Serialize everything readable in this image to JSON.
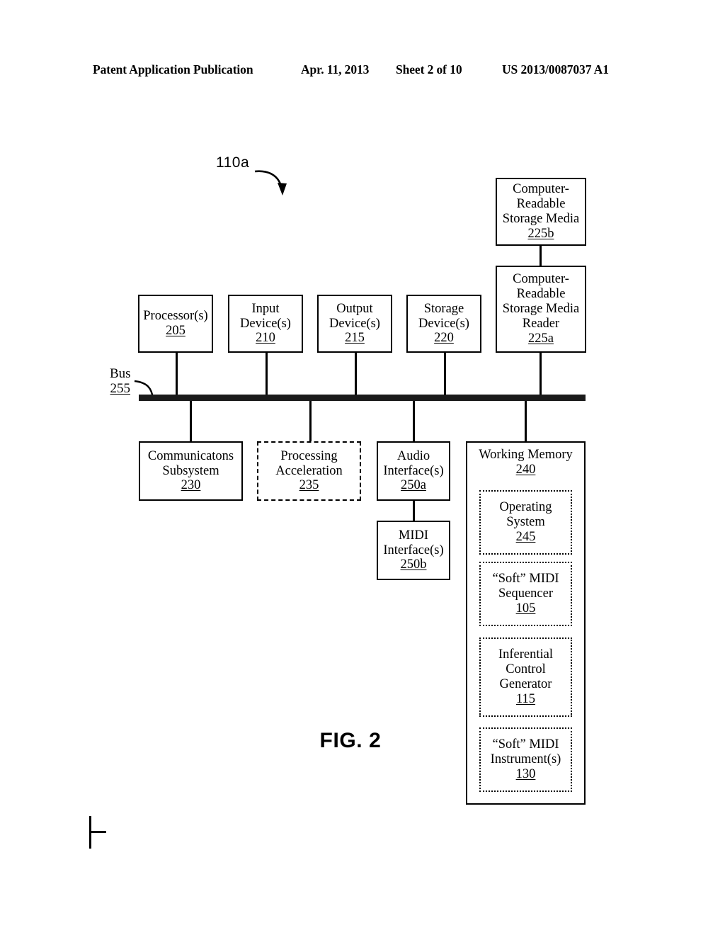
{
  "header": {
    "publication": "Patent Application Publication",
    "date": "Apr. 11, 2013",
    "sheet": "Sheet 2 of 10",
    "patent_number": "US 2013/0087037 A1"
  },
  "figure": {
    "caption": "FIG. 2",
    "system_label": "110a",
    "bus": {
      "name": "Bus",
      "ref": "255"
    },
    "nodes": {
      "storage_media": {
        "line1": "Computer-",
        "line2": "Readable",
        "line3": "Storage Media",
        "ref": "225b"
      },
      "storage_media_reader": {
        "line1": "Computer-",
        "line2": "Readable",
        "line3": "Storage Media",
        "line4": "Reader",
        "ref": "225a"
      },
      "processor": {
        "line1": "Processor(s)",
        "ref": "205"
      },
      "input_device": {
        "line1": "Input",
        "line2": "Device(s)",
        "ref": "210"
      },
      "output_device": {
        "line1": "Output",
        "line2": "Device(s)",
        "ref": "215"
      },
      "storage_device": {
        "line1": "Storage",
        "line2": "Device(s)",
        "ref": "220"
      },
      "communications_subsystem": {
        "line1": "Communicatons",
        "line2": "Subsystem",
        "ref": "230"
      },
      "processing_acceleration": {
        "line1": "Processing",
        "line2": "Acceleration",
        "ref": "235"
      },
      "audio_interface": {
        "line1": "Audio",
        "line2": "Interface(s)",
        "ref": "250a"
      },
      "midi_interface": {
        "line1": "MIDI",
        "line2": "Interface(s)",
        "ref": "250b"
      },
      "working_memory": {
        "line1": "Working Memory",
        "ref": "240"
      },
      "operating_system": {
        "line1": "Operating",
        "line2": "System",
        "ref": "245"
      },
      "soft_midi_sequencer": {
        "line1": "“Soft” MIDI",
        "line2": "Sequencer",
        "ref": "105"
      },
      "inferential_control_generator": {
        "line1": "Inferential",
        "line2": "Control",
        "line3": "Generator",
        "ref": "115"
      },
      "soft_midi_instruments": {
        "line1": "“Soft” MIDI",
        "line2": "Instrument(s)",
        "ref": "130"
      }
    }
  },
  "colors": {
    "ink": "#000000",
    "bus": "#1a1a1a",
    "paper": "#ffffff"
  }
}
